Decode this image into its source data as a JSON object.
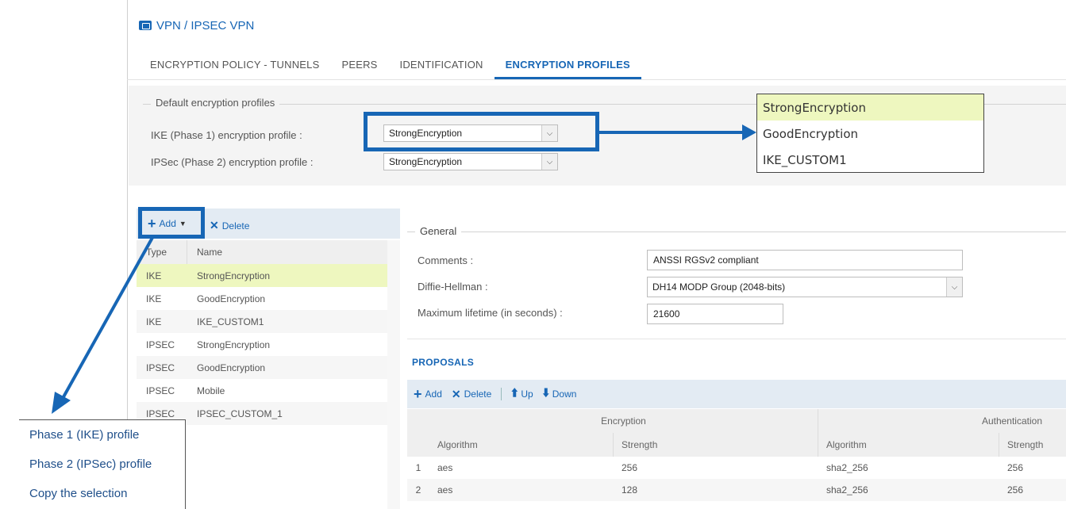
{
  "window": {
    "title": "VPN / IPSEC VPN",
    "title_icon": "vpn-icon"
  },
  "tabs": [
    {
      "label": "ENCRYPTION POLICY - TUNNELS",
      "active": false
    },
    {
      "label": "PEERS",
      "active": false
    },
    {
      "label": "IDENTIFICATION",
      "active": false
    },
    {
      "label": "ENCRYPTION PROFILES",
      "active": true
    }
  ],
  "default_profiles": {
    "legend": "Default encryption profiles",
    "ike_label": "IKE (Phase 1) encryption profile :",
    "ike_value": "StrongEncryption",
    "ipsec_label": "IPSec (Phase 2) encryption profile :",
    "ipsec_value": "StrongEncryption"
  },
  "ike_dropdown_options": [
    {
      "label": "StrongEncryption",
      "selected": true
    },
    {
      "label": "GoodEncryption",
      "selected": false
    },
    {
      "label": "IKE_CUSTOM1",
      "selected": false
    }
  ],
  "list_toolbar": {
    "add_label": "Add",
    "delete_label": "Delete"
  },
  "profile_list": {
    "columns": [
      "Type",
      "Name"
    ],
    "rows": [
      {
        "type": "IKE",
        "name": "StrongEncryption",
        "selected": true
      },
      {
        "type": "IKE",
        "name": "GoodEncryption",
        "selected": false
      },
      {
        "type": "IKE",
        "name": "IKE_CUSTOM1",
        "selected": false
      },
      {
        "type": "IPSEC",
        "name": "StrongEncryption",
        "selected": false
      },
      {
        "type": "IPSEC",
        "name": "GoodEncryption",
        "selected": false
      },
      {
        "type": "IPSEC",
        "name": "Mobile",
        "selected": false
      },
      {
        "type": "IPSEC",
        "name": "IPSEC_CUSTOM_1",
        "selected": false
      }
    ]
  },
  "add_menu": {
    "items": [
      "Phase 1 (IKE) profile",
      "Phase 2 (IPSec) profile",
      "Copy the selection"
    ]
  },
  "general": {
    "legend": "General",
    "comments_label": "Comments :",
    "comments_value": "ANSSI RGSv2 compliant",
    "dh_label": "Diffie-Hellman :",
    "dh_value": "DH14 MODP Group (2048-bits)",
    "lifetime_label": "Maximum lifetime (in seconds) :",
    "lifetime_value": "21600"
  },
  "proposals": {
    "title": "PROPOSALS",
    "toolbar": {
      "add": "Add",
      "delete": "Delete",
      "up": "Up",
      "down": "Down"
    },
    "group_headers": {
      "encryption": "Encryption",
      "authentication": "Authentication"
    },
    "columns": [
      "Algorithm",
      "Strength",
      "Algorithm",
      "Strength"
    ],
    "rows": [
      {
        "num": "1",
        "enc_alg": "aes",
        "enc_strength": "256",
        "auth_alg": "sha2_256",
        "auth_strength": "256"
      },
      {
        "num": "2",
        "enc_alg": "aes",
        "enc_strength": "128",
        "auth_alg": "sha2_256",
        "auth_strength": "256"
      }
    ]
  },
  "colors": {
    "accent": "#1766b5",
    "selected_row": "#eef7bf",
    "toolbar_bg": "#e3ebf3"
  }
}
